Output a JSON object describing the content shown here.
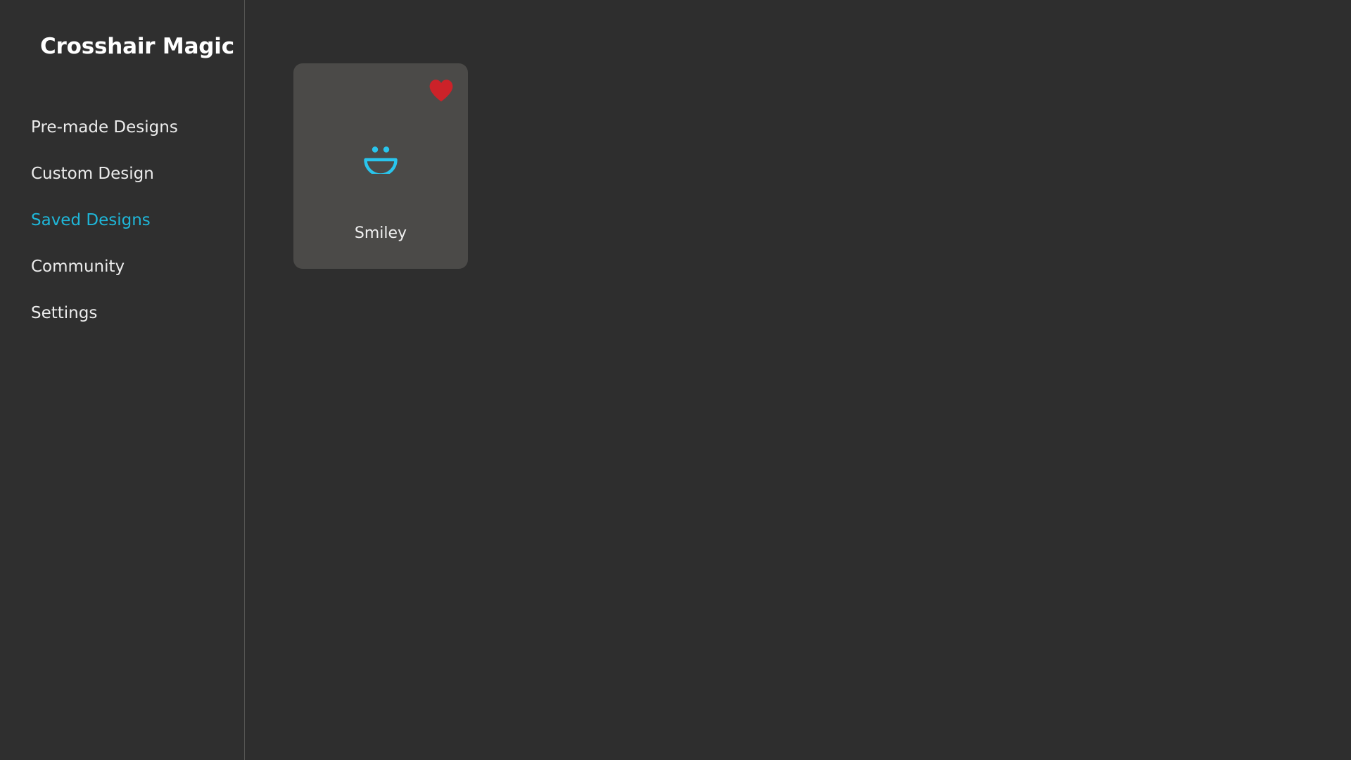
{
  "app": {
    "title": "Crosshair Magic",
    "theme": {
      "background": "#2e2e2e",
      "sidebar_background": "#2f2f2f",
      "divider": "#555553",
      "card_background": "#4b4a48",
      "accent": "#1fb6d8",
      "text": "#ececec",
      "favorite": "#cc2229"
    }
  },
  "sidebar": {
    "brand": "Crosshair Magic",
    "items": [
      {
        "label": "Pre-made Designs",
        "active": false
      },
      {
        "label": "Custom Design",
        "active": false
      },
      {
        "label": "Saved Designs",
        "active": true
      },
      {
        "label": "Community",
        "active": false
      },
      {
        "label": "Settings",
        "active": false
      }
    ]
  },
  "main": {
    "designs": [
      {
        "name": "Smiley",
        "favorite": true,
        "favorite_icon": "heart-icon",
        "preview_icon": "smiley-crosshair-icon",
        "preview_color": "#29c5ed"
      }
    ]
  }
}
